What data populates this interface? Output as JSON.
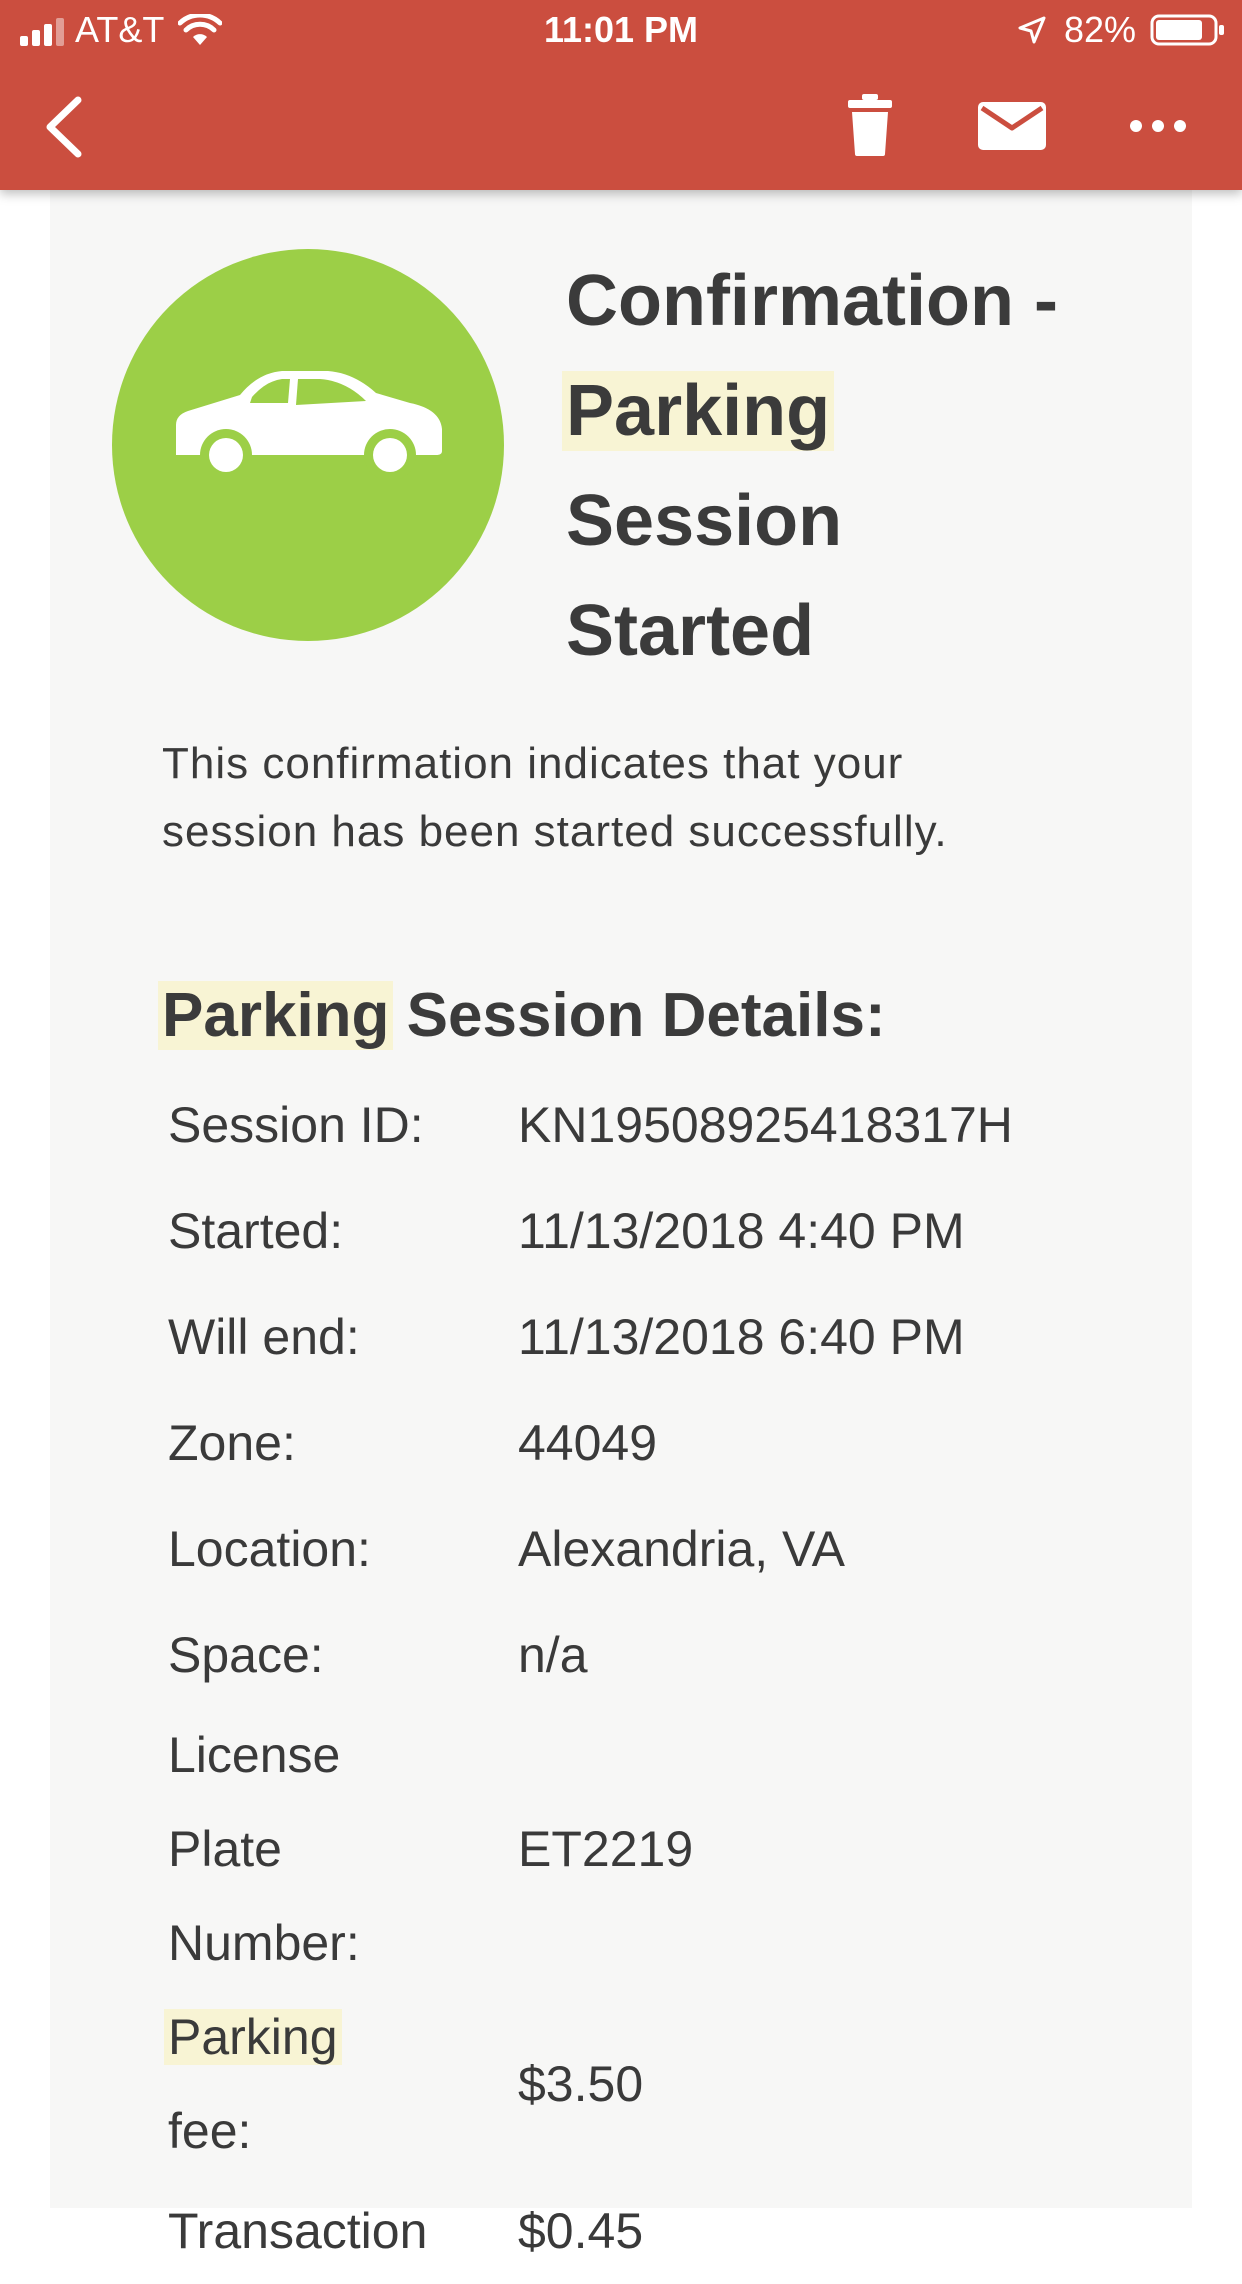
{
  "status_bar": {
    "carrier": "AT&T",
    "time": "11:01 PM",
    "battery_percent": "82%",
    "battery_level": 0.82,
    "icons": [
      "signal-icon",
      "wifi-icon",
      "location-arrow-icon",
      "battery-icon"
    ]
  },
  "toolbar": {
    "icons": [
      "back-chevron-icon",
      "trash-icon",
      "mail-icon",
      "more-icon"
    ]
  },
  "email": {
    "hero_icon": "car-icon",
    "title": {
      "line1": "Confirmation -",
      "line2": "Parking",
      "line3": "Session",
      "line4": "Started"
    },
    "intro_line1": "This confirmation indicates that your",
    "intro_line2": "session has been started successfully.",
    "section_title_highlight": "Parking",
    "section_title_rest": " Session Details:",
    "details": [
      {
        "label": "Session ID:",
        "value": "KN19508925418317H"
      },
      {
        "label": "Started:",
        "value": "11/13/2018 4:40 PM"
      },
      {
        "label": "Will end:",
        "value": "11/13/2018 6:40 PM"
      },
      {
        "label": "Zone:",
        "value": "44049"
      },
      {
        "label": "Location:",
        "value": "Alexandria, VA"
      },
      {
        "label": "Space:",
        "value": "n/a"
      },
      {
        "label_lines": [
          "License",
          "Plate",
          "Number:"
        ],
        "value": "ET2219"
      },
      {
        "label_highlight": "Parking",
        "label_rest": " fee:",
        "value": "$3.50"
      },
      {
        "label_lines": [
          "Transaction"
        ],
        "value": "$0.45"
      }
    ],
    "highlight_color": "#f8f4d4",
    "icon_color": "#9ccf47"
  },
  "colors": {
    "header": "#cb4e3f",
    "card_background": "#f7f7f6",
    "text": "#3a3a3a"
  }
}
